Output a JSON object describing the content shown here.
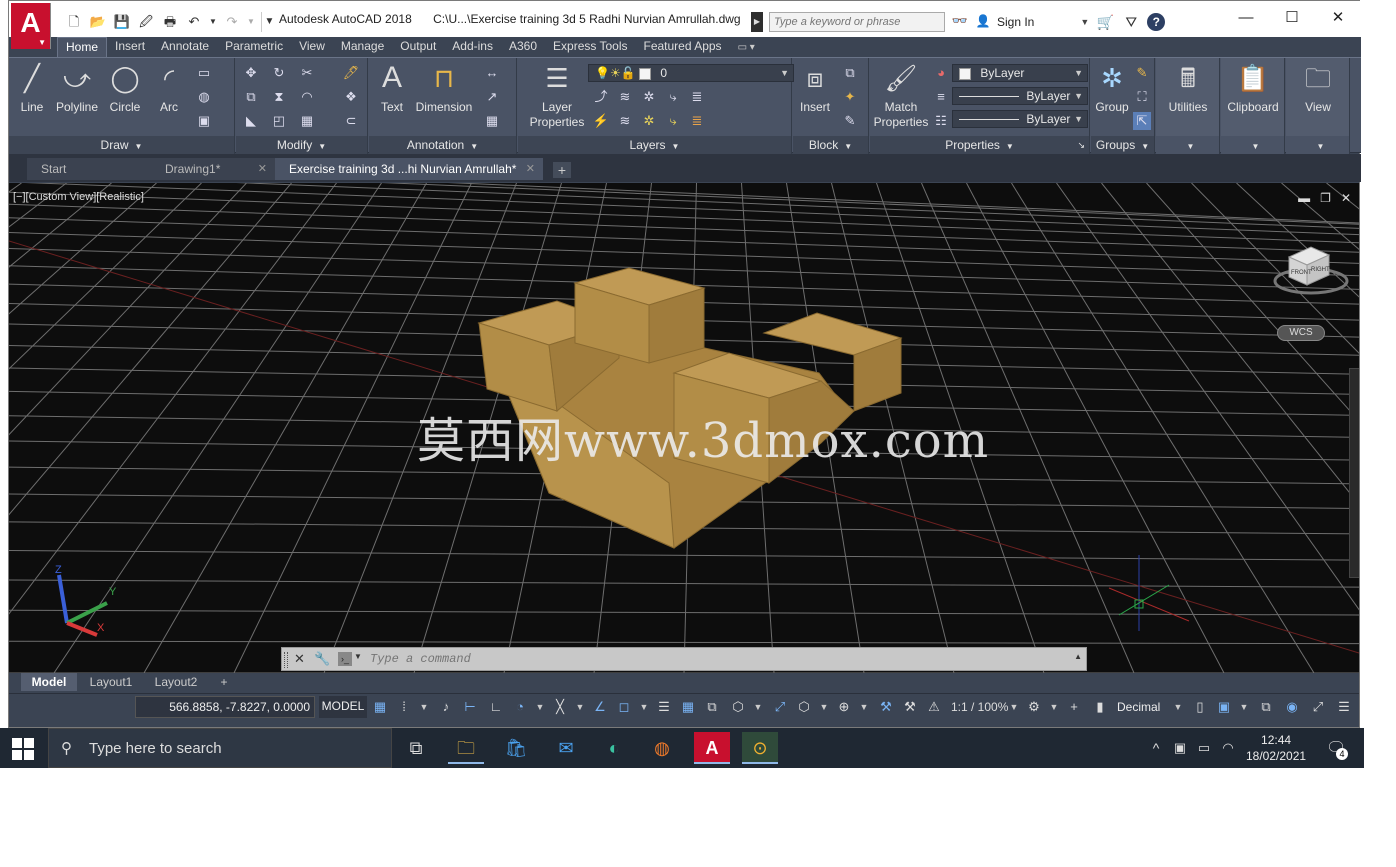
{
  "titlebar": {
    "app_name": "Autodesk AutoCAD 2018",
    "file_path": "C:\\U...\\Exercise training 3d 5 Radhi Nurvian Amrullah.dwg",
    "search_placeholder": "Type a keyword or phrase",
    "sign_in": "Sign In",
    "logo_letter": "A"
  },
  "ribbon_tabs": [
    "Home",
    "Insert",
    "Annotate",
    "Parametric",
    "View",
    "Manage",
    "Output",
    "Add-ins",
    "A360",
    "Express Tools",
    "Featured Apps"
  ],
  "panels": {
    "draw": {
      "title": "Draw",
      "line": "Line",
      "polyline": "Polyline",
      "circle": "Circle",
      "arc": "Arc"
    },
    "modify": {
      "title": "Modify"
    },
    "annotation": {
      "title": "Annotation",
      "text": "Text",
      "dimension": "Dimension"
    },
    "layers": {
      "title": "Layers",
      "layer_properties_1": "Layer",
      "layer_properties_2": "Properties",
      "current_layer": "0"
    },
    "block": {
      "title": "Block",
      "insert": "Insert"
    },
    "properties": {
      "title": "Properties",
      "match_1": "Match",
      "match_2": "Properties",
      "color": "ByLayer",
      "linetype": "ByLayer",
      "lineweight": "ByLayer"
    },
    "groups": {
      "title": "Groups",
      "group": "Group"
    },
    "utilities": {
      "title": "Utilities"
    },
    "clipboard": {
      "title": "Clipboard"
    },
    "view": {
      "title": "View"
    }
  },
  "file_tabs": [
    {
      "label": "Start"
    },
    {
      "label": "Drawing1*"
    },
    {
      "label": "Exercise training 3d ...hi Nurvian Amrullah*"
    }
  ],
  "viewport": {
    "label": "[−][Custom View][Realistic]",
    "wcs": "WCS",
    "watermark": "莫西网www.3dmox.com",
    "viewcube_front": "FRONT",
    "viewcube_right": "RIGHT",
    "ucs_z": "Z",
    "ucs_y": "Y",
    "ucs_x": "X"
  },
  "command_line": {
    "placeholder": "Type a command"
  },
  "layout_tabs": [
    "Model",
    "Layout1",
    "Layout2"
  ],
  "statusbar": {
    "coordinates": "566.8858, -7.8227, 0.0000",
    "space": "MODEL",
    "scale": "1:1 / 100%",
    "units": "Decimal"
  },
  "taskbar": {
    "search_text": "Type here to search",
    "time": "12:44",
    "date": "18/02/2021",
    "notifications": "4"
  },
  "colors": {
    "ribbon_bg": "#4a5365",
    "viewport_bg": "#0d0d0d",
    "model_fill": "#b28d47",
    "brand_red": "#c8102e"
  }
}
